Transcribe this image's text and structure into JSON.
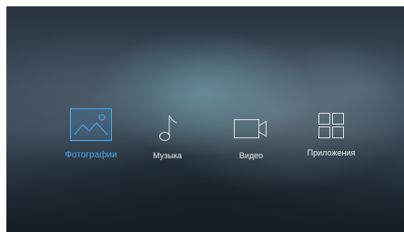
{
  "menu": {
    "items": [
      {
        "label": "Фотографии",
        "icon": "photo-icon",
        "selected": true
      },
      {
        "label": "Музыка",
        "icon": "music-note-icon",
        "selected": false
      },
      {
        "label": "Видео",
        "icon": "video-camera-icon",
        "selected": false
      },
      {
        "label": "Приложения",
        "icon": "apps-grid-icon",
        "selected": false
      }
    ]
  },
  "colors": {
    "accent": "#4aa8ef",
    "icon_stroke": "#d7dee4",
    "label_text": "#e6ecf0"
  }
}
